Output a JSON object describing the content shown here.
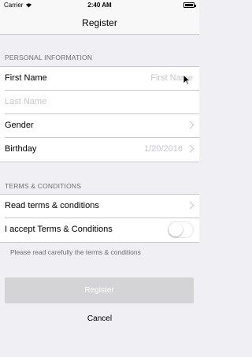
{
  "status_bar": {
    "carrier": "Carrier",
    "time": "2:40 AM"
  },
  "nav": {
    "title": "Register"
  },
  "personal": {
    "header": "PERSONAL INFORMATION",
    "first_name_label": "First Name",
    "first_name_placeholder": "First Name",
    "last_name_placeholder": "Last Name",
    "gender_label": "Gender",
    "birthday_label": "Birthday",
    "birthday_value": "1/20/2016"
  },
  "terms": {
    "header": "TERMS & CONDITIONS",
    "read_label": "Read terms & conditions",
    "accept_label": "I accept Terms & Conditions",
    "accept_on": false,
    "footnote": "Please read carefully the terms & conditions"
  },
  "actions": {
    "register_label": "Register",
    "cancel_label": "Cancel"
  },
  "colors": {
    "background": "#efeff4",
    "separator": "#c8c7cc",
    "placeholder": "#c7c7cd",
    "disabled_button": "#d4d4d6"
  }
}
